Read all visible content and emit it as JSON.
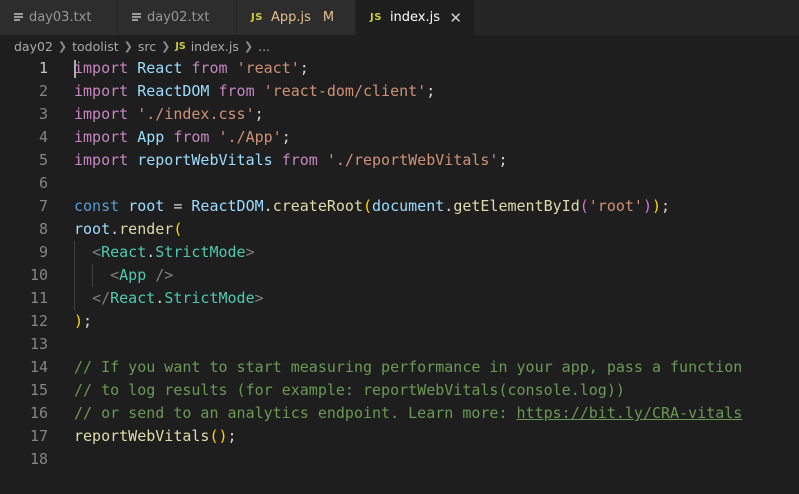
{
  "tabs": [
    {
      "label": "day03.txt",
      "icon": "text-file-icon",
      "active": false
    },
    {
      "label": "day02.txt",
      "icon": "text-file-icon",
      "active": false
    },
    {
      "label": "App.js",
      "icon": "js-file-icon",
      "badge": "M",
      "active": false
    },
    {
      "label": "index.js",
      "icon": "js-file-icon",
      "active": true,
      "close": "✕"
    }
  ],
  "js_badge": "JS",
  "breadcrumb": {
    "items": [
      "day02",
      "todolist",
      "src",
      "index.js",
      "..."
    ]
  },
  "editor": {
    "current_line": 1,
    "line_numbers": [
      "1",
      "2",
      "3",
      "4",
      "5",
      "6",
      "7",
      "8",
      "9",
      "10",
      "11",
      "12",
      "13",
      "14",
      "15",
      "16",
      "17",
      "18"
    ],
    "lines": [
      "import React from 'react';",
      "import ReactDOM from 'react-dom/client';",
      "import './index.css';",
      "import App from './App';",
      "import reportWebVitals from './reportWebVitals';",
      "",
      "const root = ReactDOM.createRoot(document.getElementById('root'));",
      "root.render(",
      "  <React.StrictMode>",
      "    <App />",
      "  </React.StrictMode>",
      ");",
      "",
      "// If you want to start measuring performance in your app, pass a function",
      "// to log results (for example: reportWebVitals(console.log))",
      "// or send to an analytics endpoint. Learn more: https://bit.ly/CRA-vitals",
      "reportWebVitals();",
      ""
    ]
  },
  "colors": {
    "background": "#1e1e1e",
    "keyword": "#c586c0",
    "string": "#ce9178",
    "variable": "#9cdcfe",
    "function": "#dcdcaa",
    "comment": "#6a9955",
    "tag": "#4ec9b0",
    "modified": "#e2c08d"
  }
}
